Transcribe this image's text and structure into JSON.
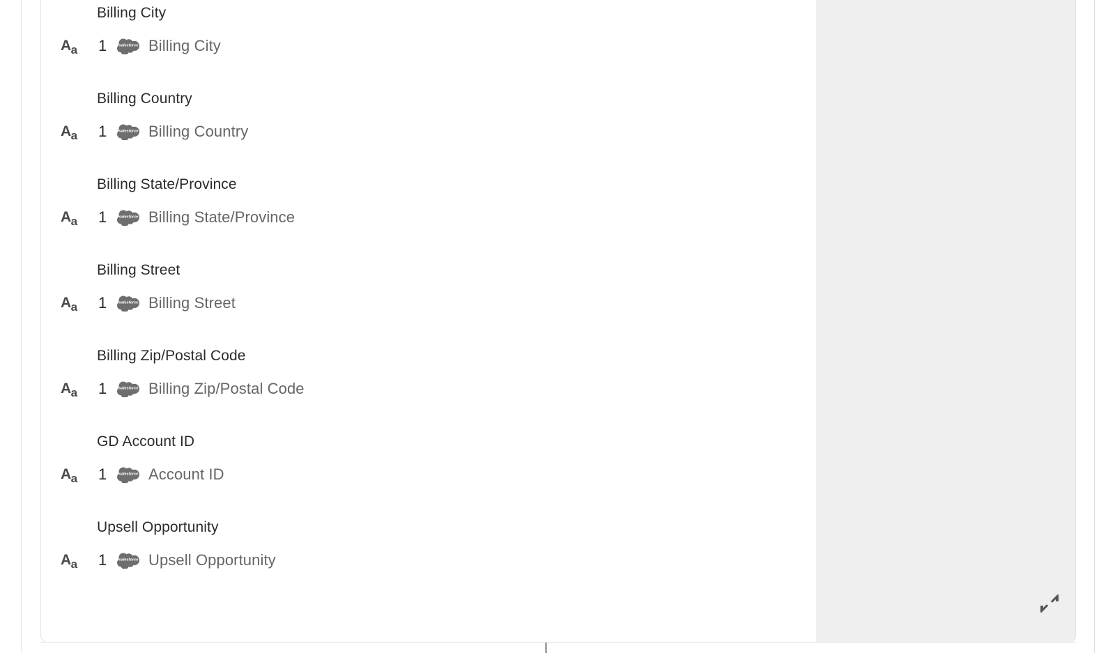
{
  "window": {
    "panel_background": "#efefef",
    "card_background": "#ffffff",
    "border_color": "#e2e2e2"
  },
  "field_mapping": {
    "type_icon_label": "Aa",
    "source_icon": "salesforce-cloud-icon",
    "source_icon_text": "salesforce",
    "groups": [
      {
        "header": "Billing City",
        "index": "1",
        "mapped_field": "Billing City"
      },
      {
        "header": "Billing Country",
        "index": "1",
        "mapped_field": "Billing Country"
      },
      {
        "header": "Billing State/Province",
        "index": "1",
        "mapped_field": "Billing State/Province"
      },
      {
        "header": "Billing Street",
        "index": "1",
        "mapped_field": "Billing Street"
      },
      {
        "header": "Billing Zip/Postal Code",
        "index": "1",
        "mapped_field": "Billing Zip/Postal Code"
      },
      {
        "header": "GD Account ID",
        "index": "1",
        "mapped_field": "Account ID"
      },
      {
        "header": "Upsell Opportunity",
        "index": "1",
        "mapped_field": "Upsell Opportunity"
      }
    ]
  },
  "preview_pane": {
    "resize_handle_icon": "expand-diagonal-icon"
  }
}
